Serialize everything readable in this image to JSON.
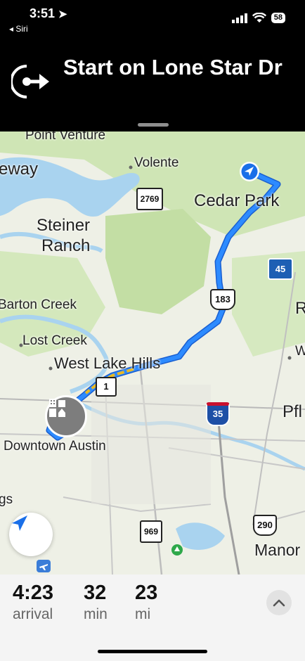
{
  "status_bar": {
    "time": "3:51",
    "back_app": "◂ Siri",
    "battery": "58"
  },
  "banner": {
    "instruction": "Start on Lone Star Dr",
    "icon": "turn-right-icon"
  },
  "map": {
    "labels": {
      "point_venture": "Point Venture",
      "eway": "eway",
      "volente": "Volente",
      "cedar_park": "Cedar Park",
      "steiner": "Steiner",
      "ranch": "Ranch",
      "barton_creek": "Barton Creek",
      "lost_creek": "Lost Creek",
      "west_lake_hills": "West Lake Hills",
      "downtown_austin": "Downtown Austin",
      "pfl": "Pfl",
      "manor": "Manor",
      "gs": "gs",
      "r": "R",
      "w": "W"
    },
    "shields": {
      "s2769": "2769",
      "s45": "45",
      "s183": "183",
      "s1": "1",
      "s35": "35",
      "s290": "290",
      "s969": "969"
    },
    "route_color": "#1a6fe8",
    "toll_color": "#e9b824"
  },
  "trip": {
    "arrival_time": "4:23",
    "arrival_label": "arrival",
    "duration": "32",
    "duration_label": "min",
    "distance": "23",
    "distance_label": "mi"
  }
}
